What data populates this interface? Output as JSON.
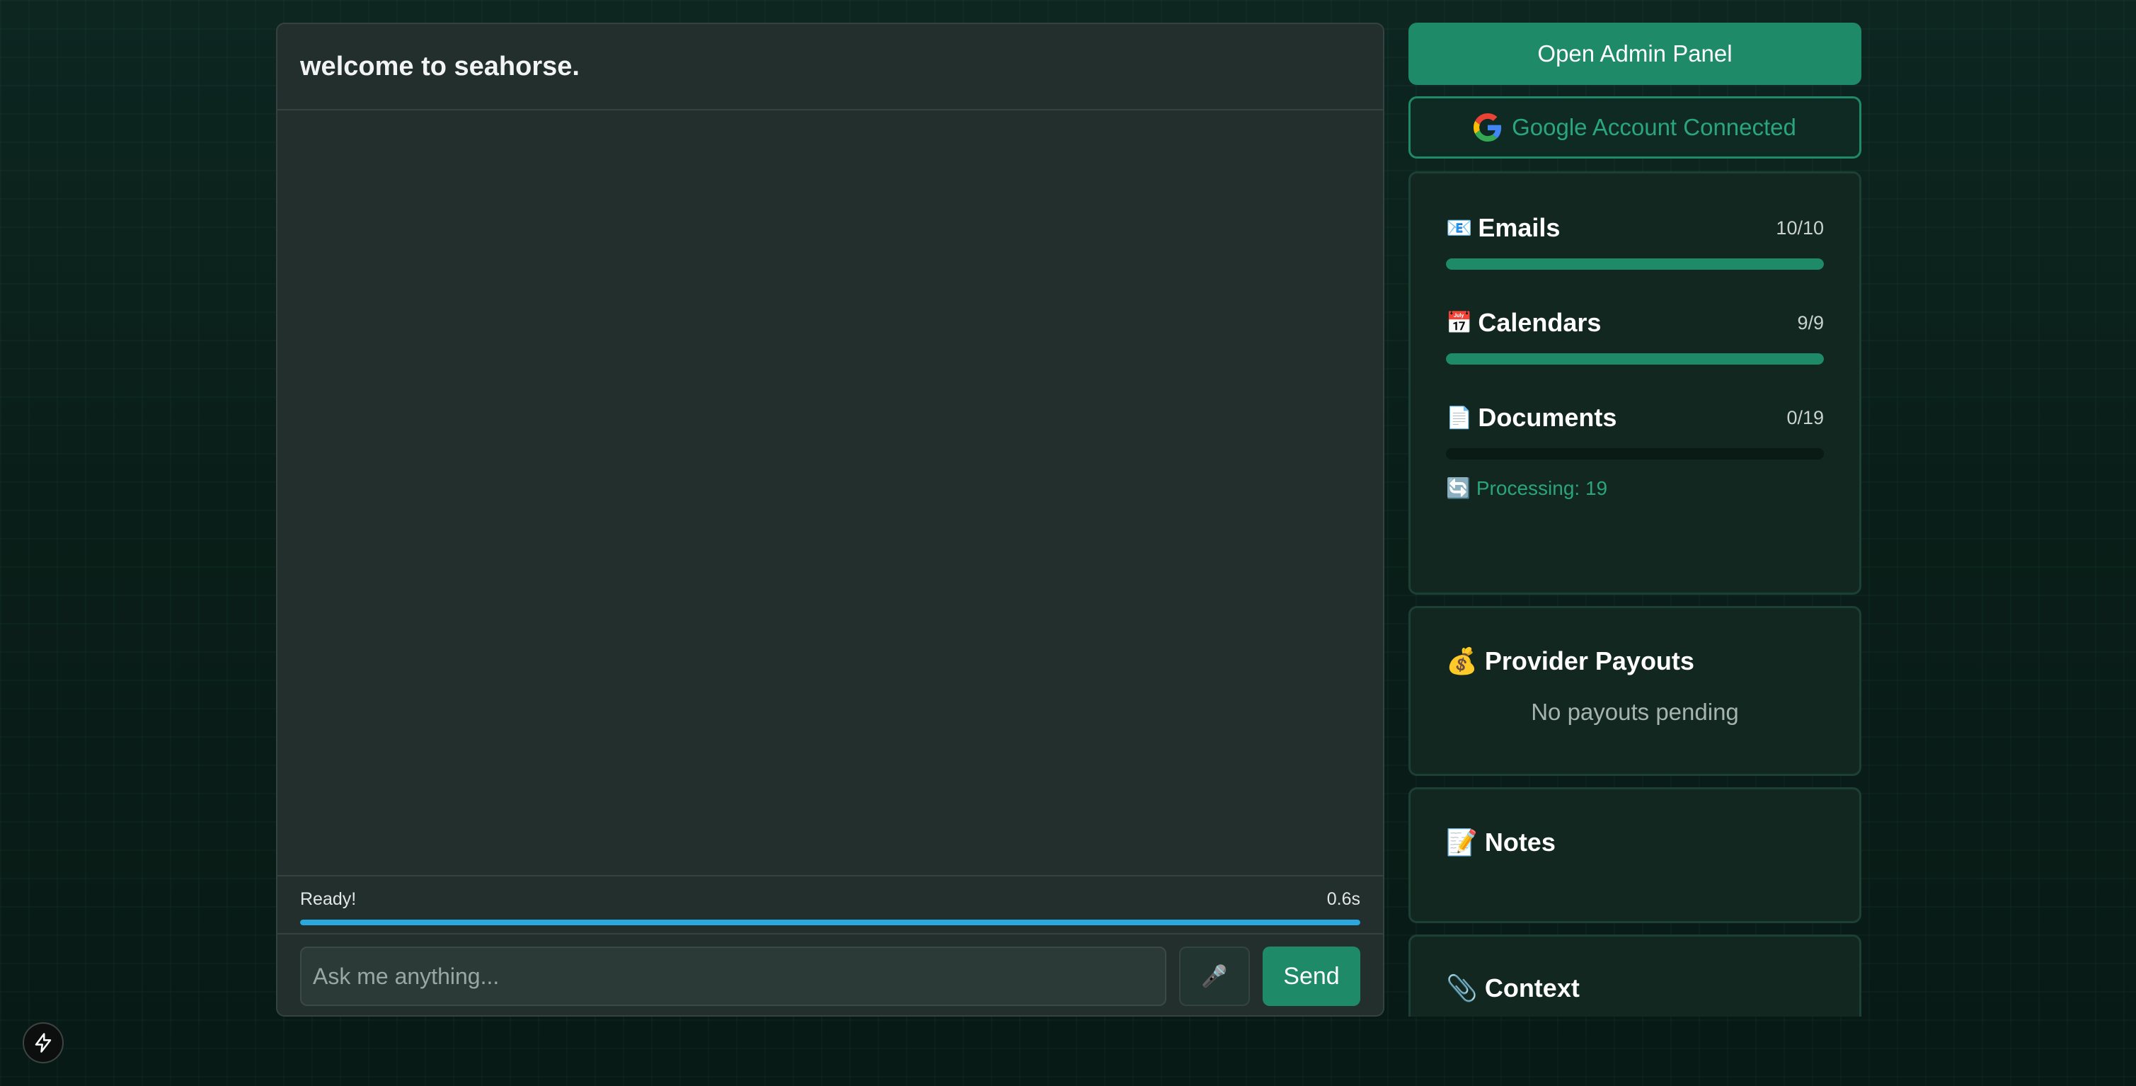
{
  "chat": {
    "title": "welcome to seahorse.",
    "status_text": "Ready!",
    "status_time": "0.6s",
    "status_progress": 1.0,
    "input_placeholder": "Ask me anything...",
    "mic_icon": "🎤",
    "send_label": "Send"
  },
  "sidebar": {
    "admin_button": "Open Admin Panel",
    "google_status": "Google Account Connected",
    "sync": {
      "emails": {
        "emoji": "📧",
        "label": "Emails",
        "count": "10/10",
        "progress": 1.0
      },
      "calendars": {
        "emoji": "📅",
        "label": "Calendars",
        "count": "9/9",
        "progress": 1.0
      },
      "documents": {
        "emoji": "📄",
        "label": "Documents",
        "count": "0/19",
        "progress": 0.0
      },
      "processing_icon": "🔄",
      "processing_text": "Processing: 19"
    },
    "payouts": {
      "emoji": "💰",
      "title": "Provider Payouts",
      "empty_text": "No payouts pending"
    },
    "notes": {
      "emoji": "📝",
      "title": "Notes"
    },
    "context": {
      "emoji": "📎",
      "title": "Context"
    }
  },
  "colors": {
    "accent": "#1f8a68",
    "accent_text": "#2aa57d",
    "status_bar": "#2ba8e0",
    "panel_bg": "#12271f"
  }
}
